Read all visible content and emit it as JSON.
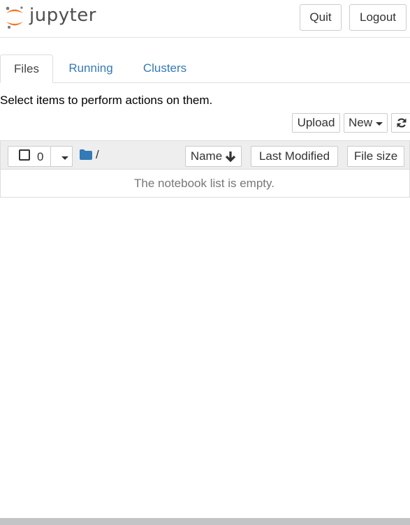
{
  "header": {
    "logo_text": "jupyter",
    "quit_label": "Quit",
    "logout_label": "Logout"
  },
  "tabs": [
    {
      "label": "Files",
      "active": true
    },
    {
      "label": "Running",
      "active": false
    },
    {
      "label": "Clusters",
      "active": false
    }
  ],
  "hint": "Select items to perform actions on them.",
  "toolbar": {
    "upload_label": "Upload",
    "new_label": "New",
    "refresh_icon": "refresh-icon"
  },
  "list_header": {
    "selected_count": "0",
    "breadcrumb": "/",
    "columns": {
      "name": "Name",
      "last_modified": "Last Modified",
      "file_size": "File size"
    }
  },
  "empty_message": "The notebook list is empty.",
  "colors": {
    "link": "#337ab7",
    "folder": "#337ab7",
    "logo_orange": "#f37726",
    "header_border": "#e3e3e3"
  }
}
